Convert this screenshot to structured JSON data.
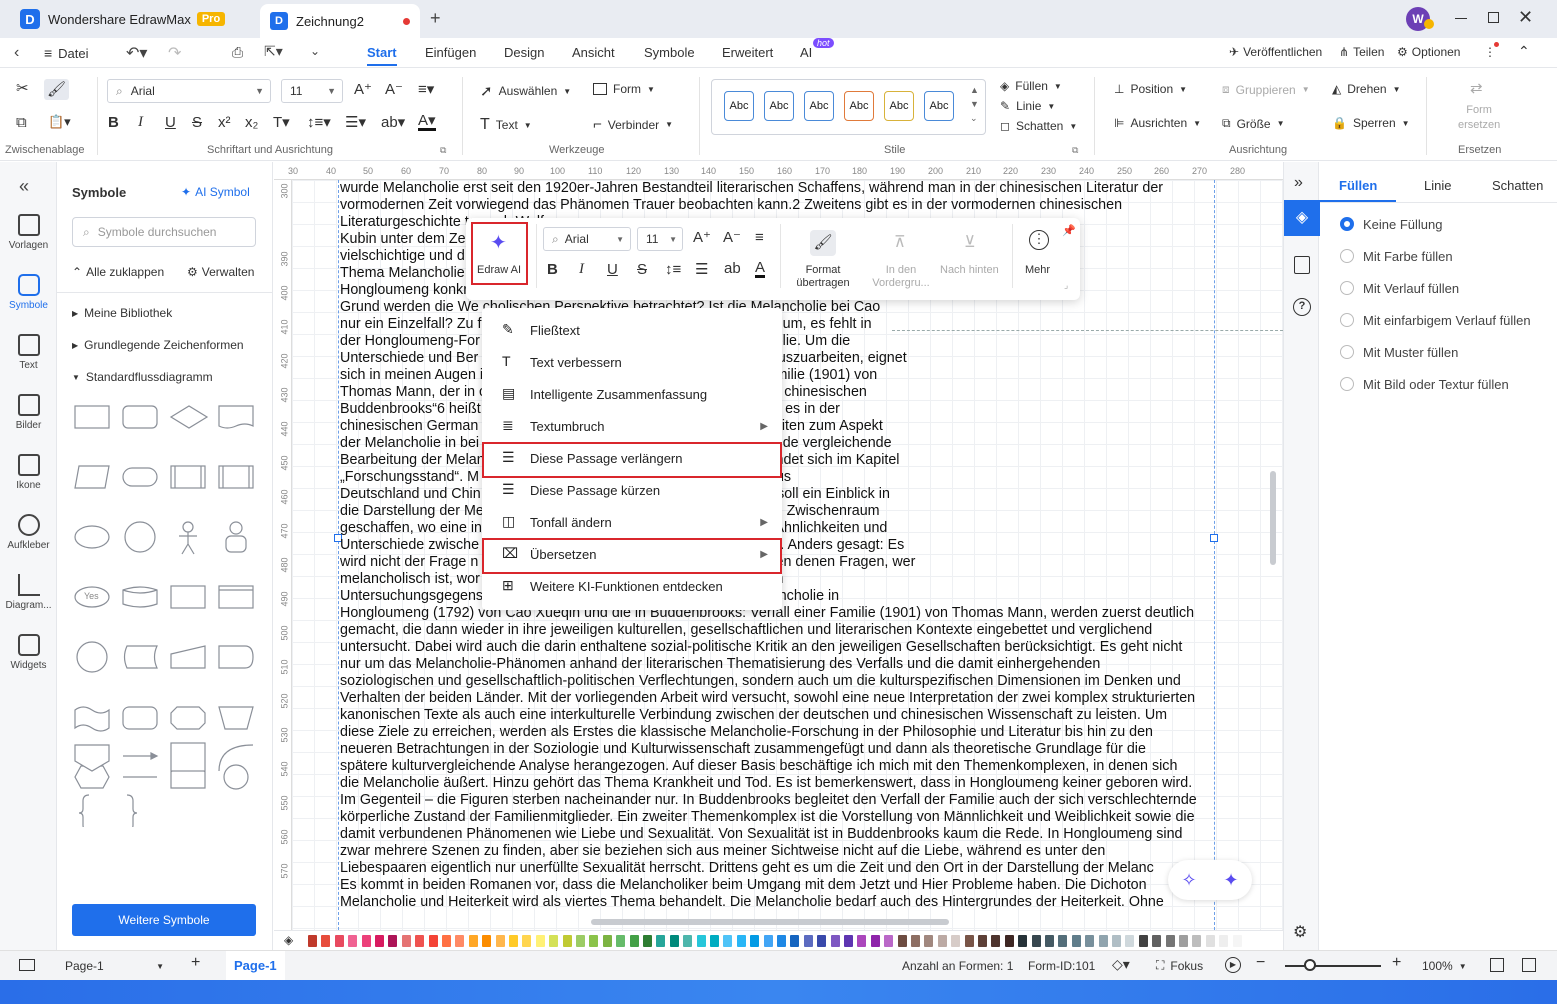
{
  "app": {
    "title": "Wondershare EdrawMax",
    "badge": "Pro",
    "doc_tab": "Zeichnung2",
    "avatar_initial": "W"
  },
  "menubar": {
    "datei": "Datei",
    "tabs": [
      "Start",
      "Einfügen",
      "Design",
      "Ansicht",
      "Symbole",
      "Erweitert",
      "AI"
    ],
    "ai_badge": "hot",
    "right": {
      "publish": "Veröffentlichen",
      "share": "Teilen",
      "options": "Optionen"
    }
  },
  "ribbon": {
    "groups": {
      "clipboard": "Zwischenablage",
      "font": "Schriftart und Ausrichtung",
      "tools": "Werkzeuge",
      "styles": "Stile",
      "align": "Ausrichtung",
      "replace": "Ersetzen"
    },
    "font_family": "Arial",
    "font_size": "11",
    "tools": {
      "select": "Auswählen",
      "form": "Form",
      "text": "Text",
      "connector": "Verbinder"
    },
    "style_sample": "Abc",
    "fill": {
      "fill": "Füllen",
      "line": "Linie",
      "shadow": "Schatten"
    },
    "arrange": {
      "position": "Position",
      "group": "Gruppieren",
      "rotate": "Drehen",
      "align": "Ausrichten",
      "size": "Größe",
      "lock": "Sperren"
    },
    "replace_form": [
      "Form",
      "ersetzen"
    ]
  },
  "leftrail": [
    "Vorlagen",
    "Symbole",
    "Text",
    "Bilder",
    "Ikone",
    "Aufkleber",
    "Diagram...",
    "Widgets"
  ],
  "symbols": {
    "title": "Symbole",
    "ai_symbol": "AI Symbol",
    "search_placeholder": "Symbole durchsuchen",
    "collapse_all": "Alle zuklappen",
    "manage": "Verwalten",
    "library": "Meine Bibliothek",
    "basic_shapes": "Grundlegende Zeichenformen",
    "flowchart": "Standardflussdiagramm",
    "more_button": "Weitere Symbole",
    "yes_label": "Yes"
  },
  "ruler": {
    "top": [
      "30",
      "40",
      "50",
      "60",
      "70",
      "80",
      "90",
      "100",
      "110",
      "120",
      "130",
      "140",
      "150",
      "160",
      "170",
      "180",
      "190",
      "200",
      "210",
      "220",
      "230",
      "240",
      "250",
      "260",
      "270",
      "280"
    ],
    "left": [
      "300",
      "",
      "390",
      "400",
      "410",
      "420",
      "430",
      "440",
      "450",
      "460",
      "470",
      "480",
      "490",
      "500",
      "510",
      "520",
      "530",
      "540",
      "550",
      "560",
      "570"
    ]
  },
  "document_lines": [
    "wurde Melancholie erst seit den 1920er-Jahren Bestandteil literarischen Schaffens, während man in der chinesischen Literatur der",
    "vormodernen Zeit vorwiegend das Phänomen Trauer beobachten kann.2 Zweitens gibt es in der vormodernen chinesischen",
    "Literaturgeschichte                                                                                    te nach Wolfgang",
    "Kubin unter dem Ze                                                                                  der eine",
    "vielschichtige und d                                                                                 d bis dato auf das",
    "Thema Melancholie                                                                                    die Melancholie in",
    "Hongloumeng konkr                                                                                    e? Aus welchem",
    "Grund werden die We                                                     cholischen Perspektive betrachtet? Ist die Melancholie bei Cao",
    "nur ein Einzelfall? Zu f                                                  Cao zu seiner Zeit melancholisch zu sein. Kurzum, es fehlt in",
    "der Hongloumeng-For                                                    Interpretation in Bezug auf das Motiv Melancholie.  Um die",
    "Unterschiede und Ber                                                    Melancholie-Konzept und dem deutschen herauszuarbeiten, eignet",
    "sich in meinen Augen                                                   ie des Romans Buddenbrooks: Verfall einer Familie (1901) von",
    "Thomas Mann, der in                                                    cht wird, während Letzterer in Deutschland „Die chinesischen",
    "Buddenbrooks“6 heißt                                                   zwischen beiden Romanen vorhanden, obwohl es in der",
    "chinesischen German                                                    ch die beiden in vielerlei Hinsicht ähneln.7 Arbeiten zum Aspekt",
    "der Melancholie in bei                                                  der deutschen Sinologie bislang eine umfassende vergleichende",
    "Bearbeitung der Melan                                                   Forschungsfelder der jeweiligen Romane befindet sich im Kapitel",
    "„Forschungsstand“. M                                                    en, die zwei gewichtigen literarischen Werke aus",
    "Deutschland und Chin                                                    le Arbeit verfolgt zwei Ziele: Über die Literatur soll ein Einblick in",
    "die Darstellung der Me                                                  ltur damit gewonnen werden. Zugleich wird ein Zwischenraum",
    "geschaffen, wo eine in                                                  en und chinesischen Kultur stattfindet, indem Ähnlichkeiten und",
    "Unterschiede zwische                                                    beitet und dann miteinander verglichen werden. Anders gesagt: Es",
    "wird nicht der Frage n                                                  ngmeng oder Buddenbrooks ist, sondern werden denen Fragen, wer",
    "melancholisch ist, wor                                                   mit wird das Phänomen Melancholie von einem",
    "Untersuchungsgegens                                                     ßt, die verschiedenen Komponenten von Melancholie in",
    "Hongloumeng (1792) von Cao Xueqin und die in Buddenbrooks: Verfall einer Familie (1901) von Thomas Mann, werden zuerst deutlich",
    "gemacht, die dann wieder in ihre jeweiligen kulturellen, gesellschaftlichen und literarischen Kontexte eingebettet und verglichend",
    "untersucht. Dabei wird auch die darin enthaltene sozial-politische Kritik an den jeweiligen Gesellschaften berücksichtigt. Es geht nicht",
    "nur um das Melancholie-Phänomen anhand der literarischen Thematisierung des Verfalls und die damit einhergehenden",
    "soziologischen und gesellschaftlich-politischen Verflechtungen, sondern auch um die kulturspezifischen Dimensionen im Denken und",
    "Verhalten der beiden Länder. Mit der vorliegenden Arbeit wird versucht, sowohl eine neue Interpretation der zwei komplex strukturierten",
    "kanonischen Texte als auch eine interkulturelle Verbindung zwischen der deutschen und chinesischen Wissenschaft zu leisten. Um",
    "diese Ziele zu erreichen, werden als Erstes die klassische Melancholie-Forschung in der Philosophie und Literatur bis hin zu den",
    "neueren Betrachtungen in der Soziologie und Kulturwissenschaft zusammengefügt und dann als theoretische Grundlage für die",
    "spätere kulturvergleichende Analyse herangezogen. Auf dieser Basis beschäftige ich mich mit den Themenkomplexen, in denen sich",
    "die Melancholie äußert. Hinzu gehört das Thema Krankheit und Tod. Es ist bemerkenswert, dass in Hongloumeng keiner geboren wird.",
    "Im Gegenteil – die Figuren sterben nacheinander nur. In Buddenbrooks begleitet den Verfall der Familie auch der sich verschlechternde",
    "körperliche Zustand der Familienmitglieder. Ein zweiter Themenkomplex ist die Vorstellung von Männlichkeit und Weiblichkeit sowie die",
    "damit verbundenen Phänomenen wie Liebe und Sexualität. Von Sexualität ist in Buddenbrooks kaum die Rede. In Hongloumeng sind",
    "zwar mehrere Szenen zu finden, aber sie beziehen sich aus meiner Sichtweise nicht auf die Liebe, während es unter den",
    "Liebespaaren eigentlich nur unerfüllte Sexualität herrscht. Drittens geht es um die Zeit und den Ort in der Darstellung der Melanc",
    "Es kommt in beiden Romanen vor, dass die Melancholiker beim Umgang mit dem Jetzt und Hier Probleme haben. Die Dichoton",
    "Melancholie und Heiterkeit wird als viertes Thema behandelt. Die Melancholie bedarf auch des Hintergrundes der Heiterkeit. Ohne"
  ],
  "floatbar": {
    "edraw_ai": "Edraw AI",
    "font_family": "Arial",
    "font_size": "11",
    "format_transfer": [
      "Format",
      "übertragen"
    ],
    "bring_front": [
      "In den",
      "Vordergru..."
    ],
    "send_back": "Nach hinten",
    "more": "Mehr"
  },
  "ai_menu": [
    {
      "label": "Fließtext",
      "icon": "pen-icon",
      "submenu": false
    },
    {
      "label": "Text verbessern",
      "icon": "text-icon",
      "submenu": false
    },
    {
      "label": "Intelligente Zusammenfassung",
      "icon": "summary-icon",
      "submenu": false
    },
    {
      "label": "Textumbruch",
      "icon": "wrap-icon",
      "submenu": true
    },
    {
      "label": "Diese Passage verlängern",
      "icon": "expand-icon",
      "submenu": false
    },
    {
      "label": "Diese Passage kürzen",
      "icon": "shorten-icon",
      "submenu": false
    },
    {
      "label": "Tonfall ändern",
      "icon": "tone-icon",
      "submenu": true
    },
    {
      "label": "Übersetzen",
      "icon": "translate-icon",
      "submenu": true
    },
    {
      "label": "Weitere KI-Funktionen entdecken",
      "icon": "plus-icon",
      "submenu": false
    }
  ],
  "props": {
    "tabs": [
      "Füllen",
      "Linie",
      "Schatten"
    ],
    "options": [
      "Keine Füllung",
      "Mit Farbe füllen",
      "Mit Verlauf füllen",
      "Mit einfarbigem Verlauf füllen",
      "Mit Muster füllen",
      "Mit Bild oder Textur füllen"
    ],
    "selected": "Keine Füllung"
  },
  "status": {
    "page_select": "Page-1",
    "page_tab": "Page-1",
    "shape_count": "Anzahl an Formen: 1",
    "form_id": "Form-ID:101",
    "focus": "Fokus",
    "zoom": "100%"
  },
  "colors": {
    "accent": "#1f6feb",
    "highlight": "#d9262c",
    "palette": [
      "#c0392b",
      "#e74c3c",
      "#e84a5f",
      "#f06292",
      "#ec407a",
      "#d81b60",
      "#ad1457",
      "#e57373",
      "#ef5350",
      "#f44336",
      "#ff7043",
      "#ff8a65",
      "#ffa726",
      "#fb8c00",
      "#ffb74d",
      "#ffca28",
      "#ffd54f",
      "#fff176",
      "#d4e157",
      "#c0ca33",
      "#9ccc65",
      "#8bc34a",
      "#7cb342",
      "#66bb6a",
      "#43a047",
      "#2e7d32",
      "#26a69a",
      "#00897b",
      "#4db6ac",
      "#26c6da",
      "#00acc1",
      "#4fc3f7",
      "#29b6f6",
      "#039be5",
      "#42a5f5",
      "#1e88e5",
      "#1565c0",
      "#5c6bc0",
      "#3949ab",
      "#7e57c2",
      "#5e35b1",
      "#ab47bc",
      "#8e24aa",
      "#ba68c8",
      "#6d4c41",
      "#8d6e63",
      "#a1887f",
      "#bcaaa4",
      "#d7ccc8",
      "#795548",
      "#5d4037",
      "#4e342e",
      "#3e2723",
      "#263238",
      "#37474f",
      "#455a64",
      "#546e7a",
      "#607d8b",
      "#78909c",
      "#90a4ae",
      "#b0bec5",
      "#cfd8dc",
      "#424242",
      "#616161",
      "#757575",
      "#9e9e9e",
      "#bdbdbd",
      "#e0e0e0",
      "#eeeeee",
      "#f5f5f5"
    ]
  }
}
